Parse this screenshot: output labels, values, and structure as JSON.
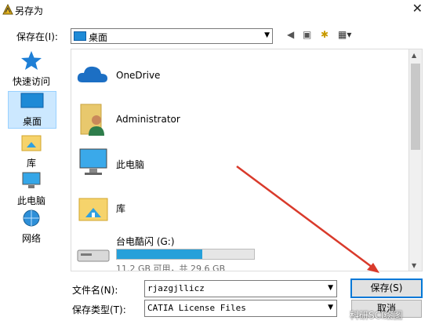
{
  "window": {
    "title": "另存为",
    "close_glyph": "✕"
  },
  "toolbar": {
    "save_in_label": "保存在(I):",
    "location": "桌面",
    "back_glyph": "◀",
    "up_glyph": "▣",
    "new_folder_glyph": "✱",
    "views_glyph": "▦▾"
  },
  "places": [
    {
      "label": "快速访问",
      "icon": "star-icon"
    },
    {
      "label": "桌面",
      "icon": "desktop-icon"
    },
    {
      "label": "库",
      "icon": "library-icon"
    },
    {
      "label": "此电脑",
      "icon": "computer-icon"
    },
    {
      "label": "网络",
      "icon": "network-icon"
    }
  ],
  "files": [
    {
      "label": "OneDrive",
      "icon": "cloud-icon"
    },
    {
      "label": "Administrator",
      "icon": "user-folder-icon"
    },
    {
      "label": "此电脑",
      "icon": "computer-icon"
    },
    {
      "label": "库",
      "icon": "library-icon"
    }
  ],
  "drive": {
    "label": "台电酷闪 (G:)",
    "info": "11.2 GB 可用，共 29.6 GB",
    "used_fraction": 0.62
  },
  "filename": {
    "label": "文件名(N):",
    "value": "rjazgjllicz"
  },
  "filetype": {
    "label": "保存类型(T):",
    "value": "CATIA License Files"
  },
  "buttons": {
    "save": "保存(S)",
    "cancel": "取消"
  },
  "watermark": "科研SCI绘图",
  "colors": {
    "accent": "#0078d7",
    "drive_bar": "#26a0da",
    "arrow": "#d93a2b"
  }
}
